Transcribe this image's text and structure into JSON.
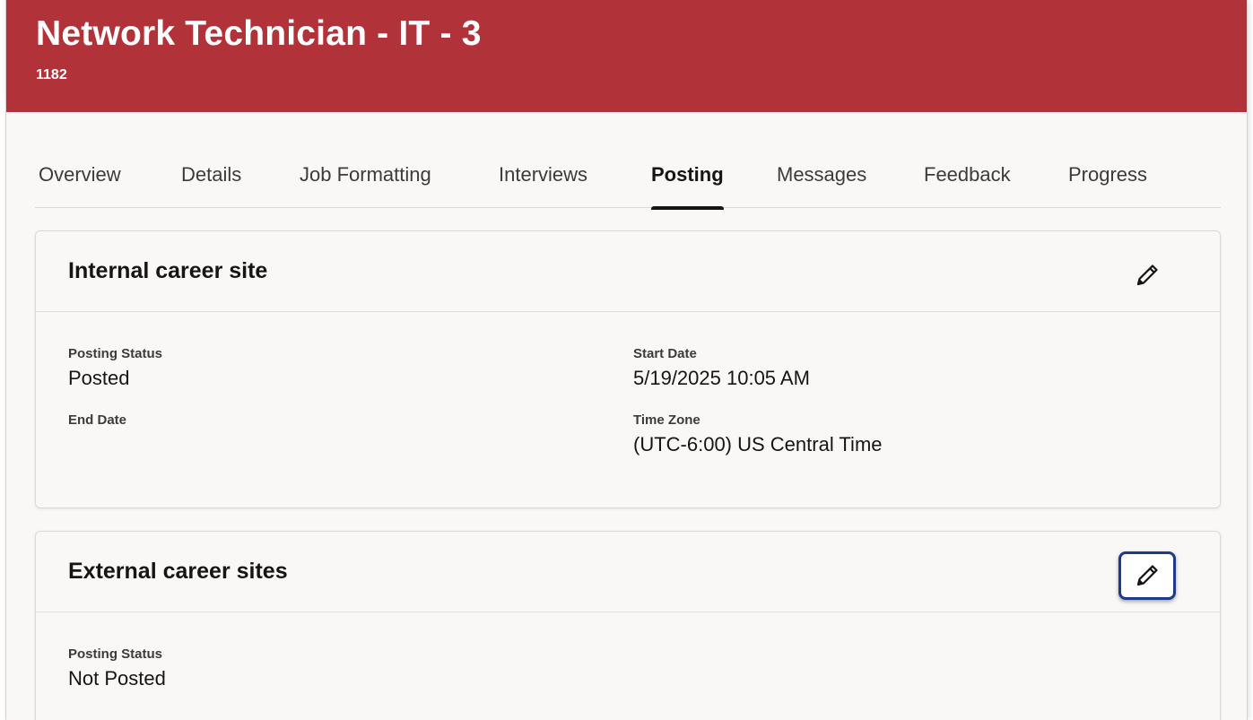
{
  "header": {
    "title": "Network Technician - IT - 3",
    "subtitle": "1182",
    "color": "#b2323a"
  },
  "tabs": [
    {
      "label": "Overview",
      "active": false
    },
    {
      "label": "Details",
      "active": false
    },
    {
      "label": "Job Formatting",
      "active": false
    },
    {
      "label": "Interviews",
      "active": false
    },
    {
      "label": "Posting",
      "active": true
    },
    {
      "label": "Messages",
      "active": false
    },
    {
      "label": "Feedback",
      "active": false
    },
    {
      "label": "Progress",
      "active": false
    }
  ],
  "internal": {
    "title": "Internal career site",
    "edit_icon": "pencil-icon",
    "posting_status_label": "Posting Status",
    "posting_status_value": "Posted",
    "end_date_label": "End Date",
    "start_date_label": "Start Date",
    "start_date_value": "5/19/2025 10:05 AM",
    "time_zone_label": "Time Zone",
    "time_zone_value": "(UTC-6:00) US Central Time"
  },
  "external": {
    "title": "External career sites",
    "edit_icon": "pencil-icon",
    "posting_status_label": "Posting Status",
    "posting_status_value": "Not Posted"
  },
  "colors": {
    "focus_ring": "#1e3a8a",
    "background": "#f9f8f6"
  }
}
